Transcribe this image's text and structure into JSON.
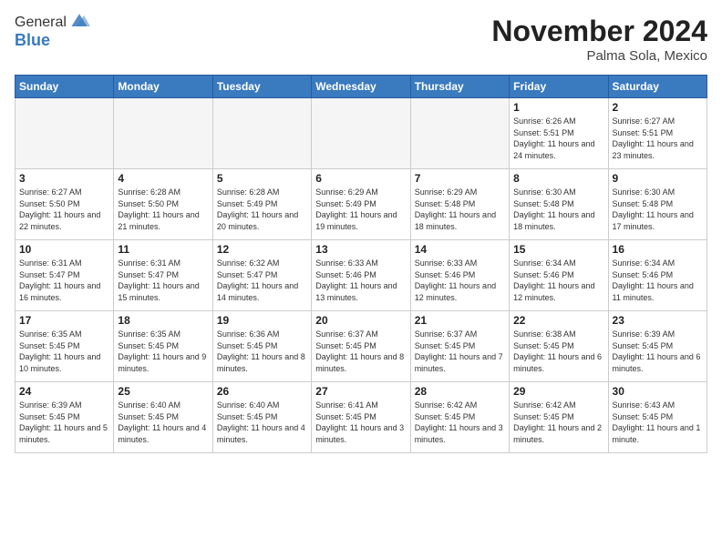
{
  "header": {
    "logo_general": "General",
    "logo_blue": "Blue",
    "month_title": "November 2024",
    "location": "Palma Sola, Mexico"
  },
  "days_of_week": [
    "Sunday",
    "Monday",
    "Tuesday",
    "Wednesday",
    "Thursday",
    "Friday",
    "Saturday"
  ],
  "weeks": [
    [
      {
        "day": "",
        "info": ""
      },
      {
        "day": "",
        "info": ""
      },
      {
        "day": "",
        "info": ""
      },
      {
        "day": "",
        "info": ""
      },
      {
        "day": "",
        "info": ""
      },
      {
        "day": "1",
        "info": "Sunrise: 6:26 AM\nSunset: 5:51 PM\nDaylight: 11 hours and 24 minutes."
      },
      {
        "day": "2",
        "info": "Sunrise: 6:27 AM\nSunset: 5:51 PM\nDaylight: 11 hours and 23 minutes."
      }
    ],
    [
      {
        "day": "3",
        "info": "Sunrise: 6:27 AM\nSunset: 5:50 PM\nDaylight: 11 hours and 22 minutes."
      },
      {
        "day": "4",
        "info": "Sunrise: 6:28 AM\nSunset: 5:50 PM\nDaylight: 11 hours and 21 minutes."
      },
      {
        "day": "5",
        "info": "Sunrise: 6:28 AM\nSunset: 5:49 PM\nDaylight: 11 hours and 20 minutes."
      },
      {
        "day": "6",
        "info": "Sunrise: 6:29 AM\nSunset: 5:49 PM\nDaylight: 11 hours and 19 minutes."
      },
      {
        "day": "7",
        "info": "Sunrise: 6:29 AM\nSunset: 5:48 PM\nDaylight: 11 hours and 18 minutes."
      },
      {
        "day": "8",
        "info": "Sunrise: 6:30 AM\nSunset: 5:48 PM\nDaylight: 11 hours and 18 minutes."
      },
      {
        "day": "9",
        "info": "Sunrise: 6:30 AM\nSunset: 5:48 PM\nDaylight: 11 hours and 17 minutes."
      }
    ],
    [
      {
        "day": "10",
        "info": "Sunrise: 6:31 AM\nSunset: 5:47 PM\nDaylight: 11 hours and 16 minutes."
      },
      {
        "day": "11",
        "info": "Sunrise: 6:31 AM\nSunset: 5:47 PM\nDaylight: 11 hours and 15 minutes."
      },
      {
        "day": "12",
        "info": "Sunrise: 6:32 AM\nSunset: 5:47 PM\nDaylight: 11 hours and 14 minutes."
      },
      {
        "day": "13",
        "info": "Sunrise: 6:33 AM\nSunset: 5:46 PM\nDaylight: 11 hours and 13 minutes."
      },
      {
        "day": "14",
        "info": "Sunrise: 6:33 AM\nSunset: 5:46 PM\nDaylight: 11 hours and 12 minutes."
      },
      {
        "day": "15",
        "info": "Sunrise: 6:34 AM\nSunset: 5:46 PM\nDaylight: 11 hours and 12 minutes."
      },
      {
        "day": "16",
        "info": "Sunrise: 6:34 AM\nSunset: 5:46 PM\nDaylight: 11 hours and 11 minutes."
      }
    ],
    [
      {
        "day": "17",
        "info": "Sunrise: 6:35 AM\nSunset: 5:45 PM\nDaylight: 11 hours and 10 minutes."
      },
      {
        "day": "18",
        "info": "Sunrise: 6:35 AM\nSunset: 5:45 PM\nDaylight: 11 hours and 9 minutes."
      },
      {
        "day": "19",
        "info": "Sunrise: 6:36 AM\nSunset: 5:45 PM\nDaylight: 11 hours and 8 minutes."
      },
      {
        "day": "20",
        "info": "Sunrise: 6:37 AM\nSunset: 5:45 PM\nDaylight: 11 hours and 8 minutes."
      },
      {
        "day": "21",
        "info": "Sunrise: 6:37 AM\nSunset: 5:45 PM\nDaylight: 11 hours and 7 minutes."
      },
      {
        "day": "22",
        "info": "Sunrise: 6:38 AM\nSunset: 5:45 PM\nDaylight: 11 hours and 6 minutes."
      },
      {
        "day": "23",
        "info": "Sunrise: 6:39 AM\nSunset: 5:45 PM\nDaylight: 11 hours and 6 minutes."
      }
    ],
    [
      {
        "day": "24",
        "info": "Sunrise: 6:39 AM\nSunset: 5:45 PM\nDaylight: 11 hours and 5 minutes."
      },
      {
        "day": "25",
        "info": "Sunrise: 6:40 AM\nSunset: 5:45 PM\nDaylight: 11 hours and 4 minutes."
      },
      {
        "day": "26",
        "info": "Sunrise: 6:40 AM\nSunset: 5:45 PM\nDaylight: 11 hours and 4 minutes."
      },
      {
        "day": "27",
        "info": "Sunrise: 6:41 AM\nSunset: 5:45 PM\nDaylight: 11 hours and 3 minutes."
      },
      {
        "day": "28",
        "info": "Sunrise: 6:42 AM\nSunset: 5:45 PM\nDaylight: 11 hours and 3 minutes."
      },
      {
        "day": "29",
        "info": "Sunrise: 6:42 AM\nSunset: 5:45 PM\nDaylight: 11 hours and 2 minutes."
      },
      {
        "day": "30",
        "info": "Sunrise: 6:43 AM\nSunset: 5:45 PM\nDaylight: 11 hours and 1 minute."
      }
    ]
  ]
}
